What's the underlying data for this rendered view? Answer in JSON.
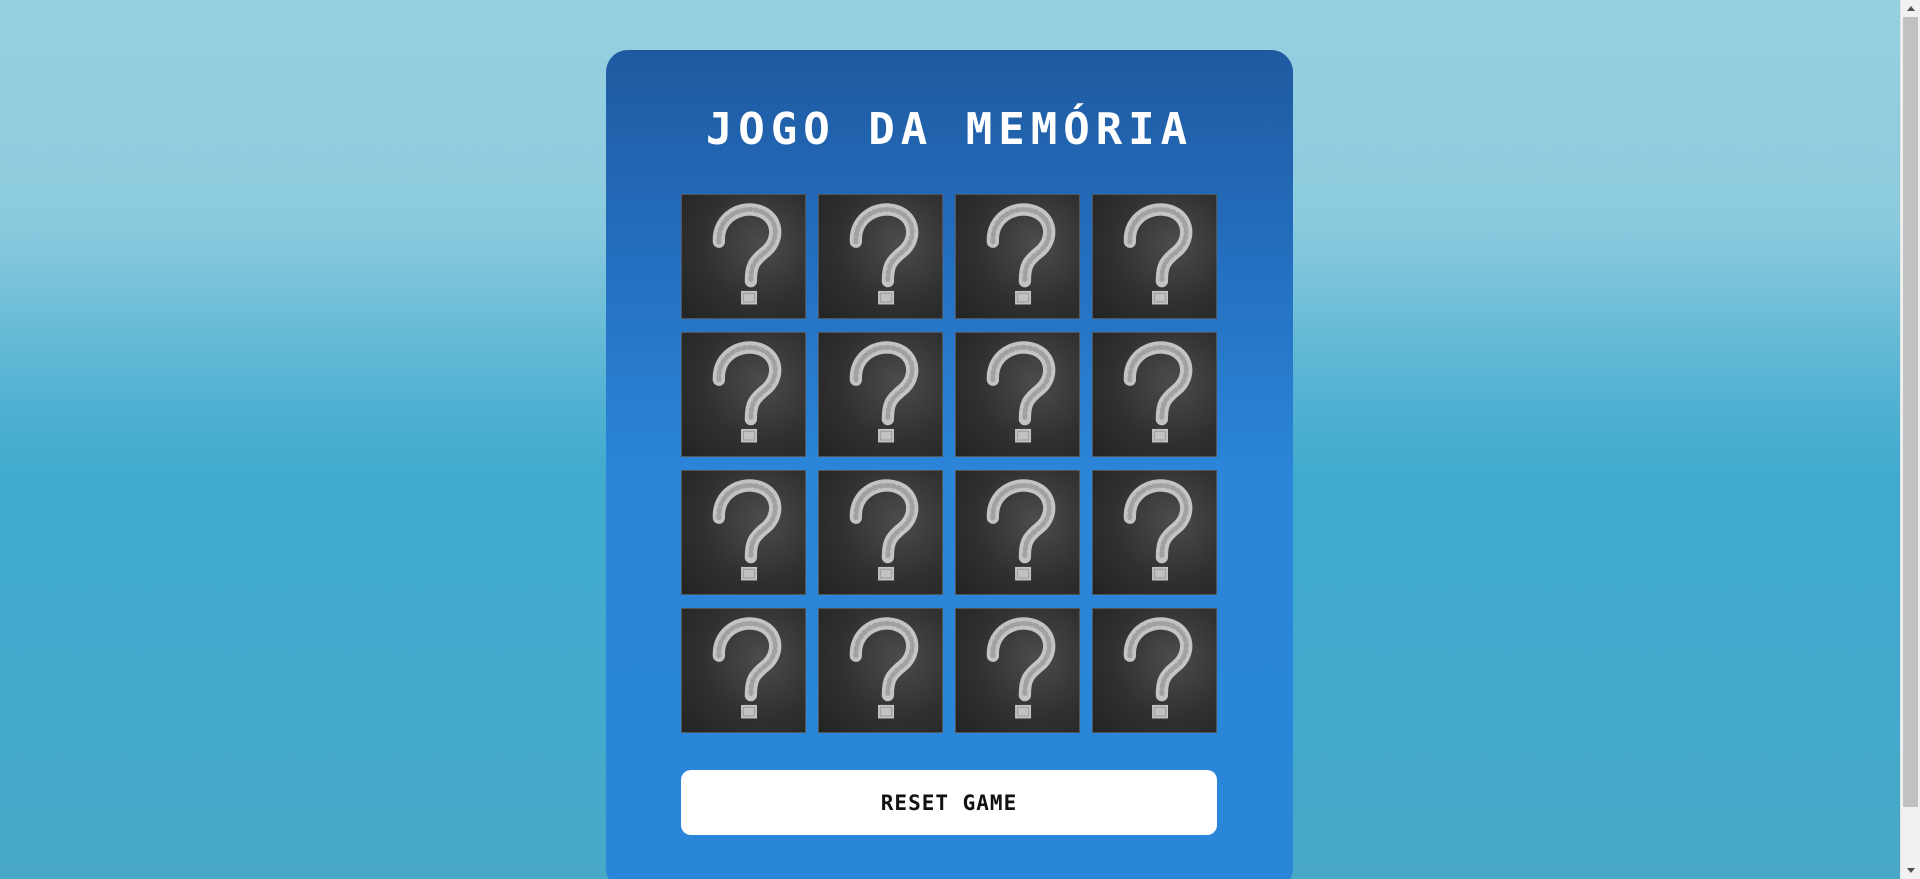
{
  "game": {
    "title": "JOGO DA MEMÓRIA",
    "reset_label": "RESET GAME",
    "card_back_icon": "chalk-question-mark-icon",
    "card_count": 16,
    "columns": 4,
    "rows": 4,
    "cards": [
      {
        "state": "face-down"
      },
      {
        "state": "face-down"
      },
      {
        "state": "face-down"
      },
      {
        "state": "face-down"
      },
      {
        "state": "face-down"
      },
      {
        "state": "face-down"
      },
      {
        "state": "face-down"
      },
      {
        "state": "face-down"
      },
      {
        "state": "face-down"
      },
      {
        "state": "face-down"
      },
      {
        "state": "face-down"
      },
      {
        "state": "face-down"
      },
      {
        "state": "face-down"
      },
      {
        "state": "face-down"
      },
      {
        "state": "face-down"
      },
      {
        "state": "face-down"
      }
    ]
  },
  "colors": {
    "page_background_top": "#95d0e0",
    "page_background_bottom": "#43a9cb",
    "panel_top": "#1f5aa0",
    "panel_bottom": "#2a86d8",
    "card_back": "#2f2f2f",
    "chalk": "#dcdcdc",
    "button_background": "#ffffff",
    "button_text": "#111111"
  }
}
